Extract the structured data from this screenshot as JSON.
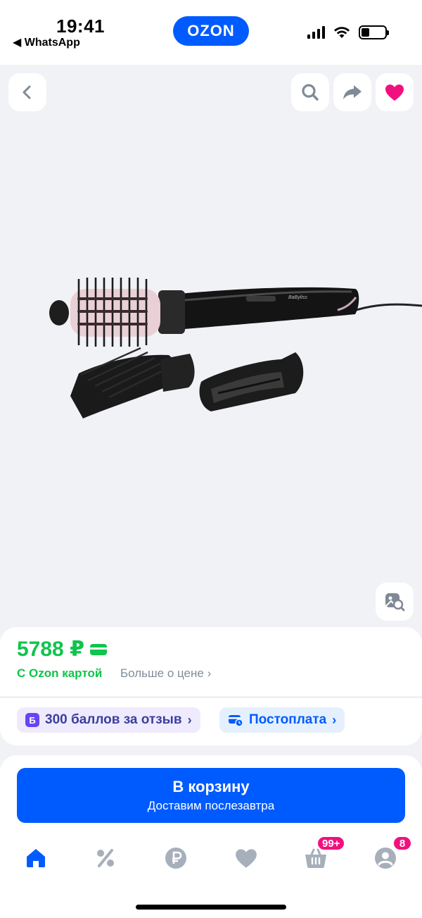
{
  "status_bar": {
    "time": "19:41",
    "back_app": "◀ WhatsApp",
    "logo": "OZON"
  },
  "gallery": {
    "buttons": [
      "back-icon",
      "search-icon",
      "share-icon",
      "heart-icon",
      "similar-search-icon"
    ]
  },
  "price": {
    "value": "5788 ₽",
    "ozon_card_label": "С Ozon картой",
    "more_label": "Больше о цене"
  },
  "badges": {
    "points_letter": "Б",
    "points_label": "300 баллов за отзыв",
    "postpay_label": "Постоплата"
  },
  "cart_button": {
    "title": "В корзину",
    "subtitle": "Доставим послезавтра"
  },
  "tabbar": {
    "items": [
      "home-icon",
      "percent-icon",
      "ruble-icon",
      "favorites-icon",
      "cart-icon",
      "profile-icon"
    ],
    "cart_counter": "99+",
    "profile_counter": "8"
  },
  "colors": {
    "brand": "#005bff",
    "price_green": "#10c44c",
    "counter_pink": "#f1117e",
    "heart_pink": "#f1117e"
  }
}
